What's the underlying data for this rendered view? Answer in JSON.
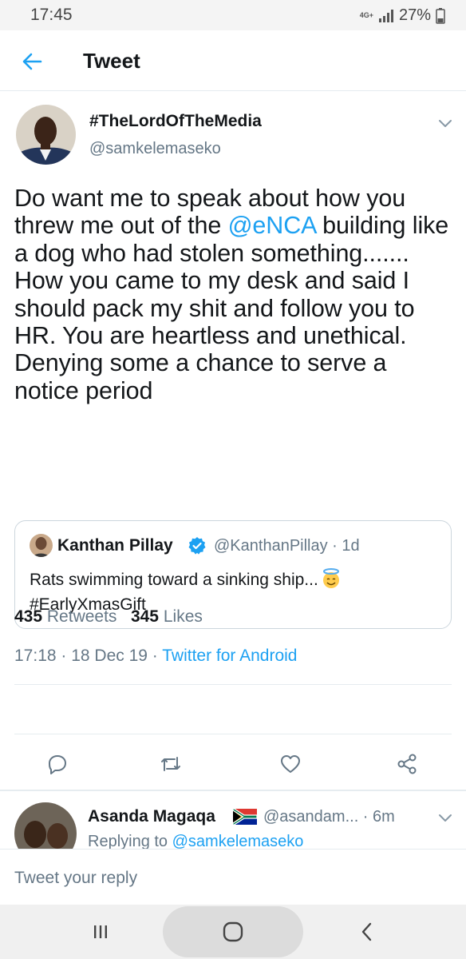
{
  "status_bar": {
    "time": "17:45",
    "network": "4G+",
    "battery": "27%"
  },
  "header": {
    "title": "Tweet",
    "back_icon": "arrow-left-icon"
  },
  "tweet": {
    "display_name": "#TheLordOfTheMedia",
    "handle": "@samkelemaseko",
    "text_before": "Do want me to speak about how you threw me out of the ",
    "text_mention": "@eNCA",
    "text_after": " building like a dog who had stolen something....... How you came to my desk and said I should pack my shit and follow you to HR. You are heartless and unethical. Denying some a chance to serve a notice period",
    "timestamp": "17:18 · 18 Dec 19 · ",
    "source": "Twitter for Android",
    "retweet_count": "435",
    "retweet_label": "Retweets",
    "like_count": "345",
    "like_label": "Likes"
  },
  "quoted_tweet": {
    "display_name": "Kanthan Pillay",
    "handle_time": "@KanthanPillay · 1d",
    "text_line1": "Rats swimming toward a sinking ship...",
    "text_line2": "#EarlyXmasGift"
  },
  "actions": [
    "reply-icon",
    "retweet-icon",
    "like-icon",
    "share-icon"
  ],
  "reply": {
    "display_name": "Asanda Magaqa",
    "handle_time": "@asandam... · 6m",
    "replying_prefix": "Replying to ",
    "replying_to": "@samkelemaseko"
  },
  "compose": {
    "placeholder": "Tweet your reply"
  },
  "colors": {
    "accent": "#1da1f2",
    "secondary_text": "#657786",
    "primary_text": "#14171a",
    "divider": "#e6ecf0"
  }
}
